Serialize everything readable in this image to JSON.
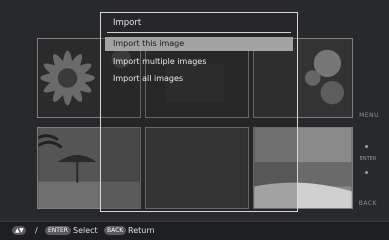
{
  "dialog": {
    "title": "Import",
    "items": [
      {
        "label": "Import this image",
        "selected": true
      },
      {
        "label": "Import multiple images",
        "selected": false
      },
      {
        "label": "Import all images",
        "selected": false
      }
    ]
  },
  "side_hints": {
    "menu": "MENU",
    "enter": "ENTER",
    "back": "BACK"
  },
  "bottom_bar": {
    "separator": "/",
    "enter_pill": "ENTER",
    "select_label": "Select",
    "back_pill": "BACK",
    "return_label": "Return"
  }
}
